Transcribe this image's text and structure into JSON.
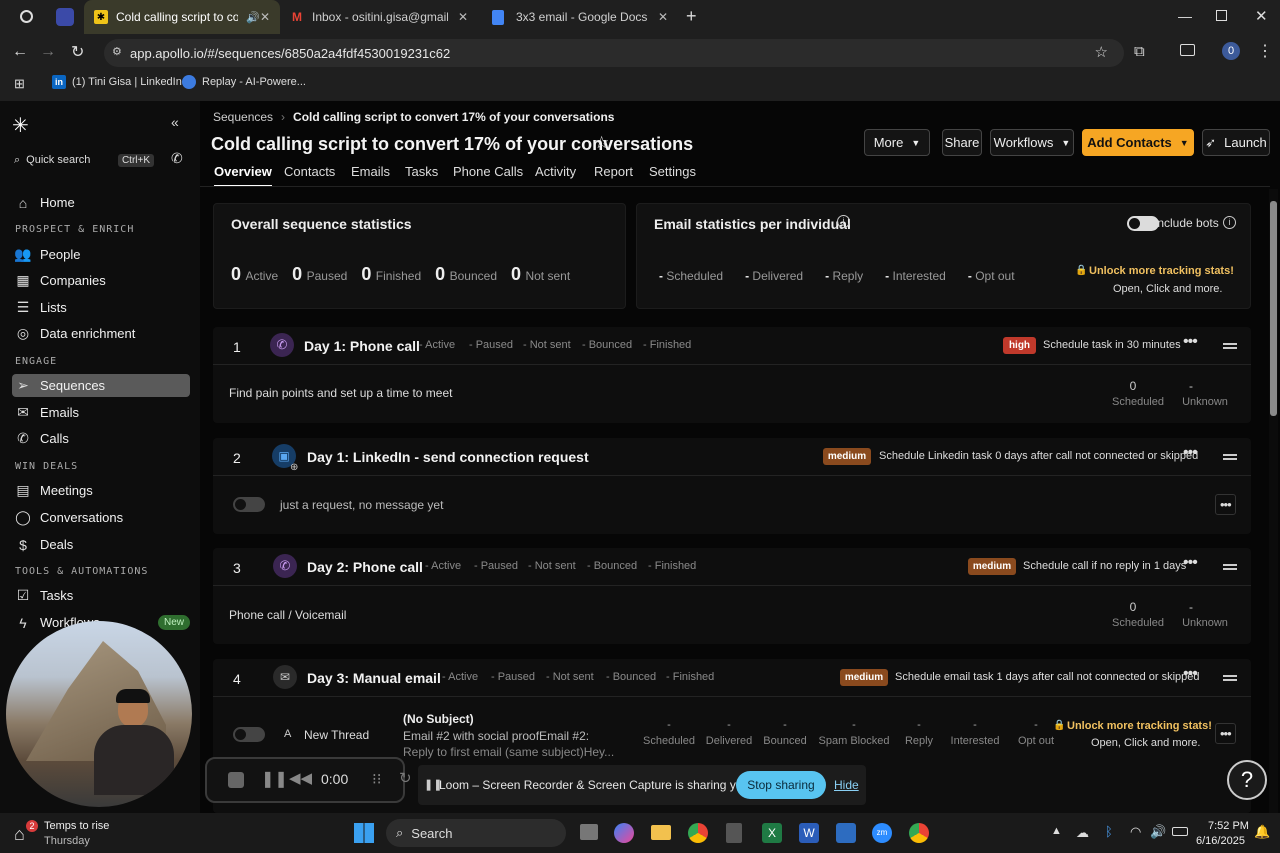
{
  "browser": {
    "tabs": [
      {
        "title": "Cold calling script to conve",
        "active": true
      },
      {
        "title": "Inbox - ositini.gisa@gmail.com"
      },
      {
        "title": "3x3 email - Google Docs"
      }
    ],
    "url": "app.apollo.io/#/sequences/6850a2a4fdf4530019231c62",
    "profile_initial": "0",
    "bookmarks": [
      "(1) Tini Gisa | LinkedIn",
      "Replay - AI-Powere..."
    ]
  },
  "sidebar": {
    "quick_search": "Quick search",
    "shortcut": "Ctrl+K",
    "home": "Home",
    "sections": [
      {
        "heading": "PROSPECT & ENRICH",
        "items": [
          "People",
          "Companies",
          "Lists",
          "Data enrichment"
        ]
      },
      {
        "heading": "ENGAGE",
        "items": [
          "Sequences",
          "Emails",
          "Calls"
        ]
      },
      {
        "heading": "WIN DEALS",
        "items": [
          "Meetings",
          "Conversations",
          "Deals"
        ]
      },
      {
        "heading": "TOOLS & AUTOMATIONS",
        "items": [
          "Tasks",
          "Workflows"
        ]
      }
    ],
    "new_badge": "New",
    "active_item": "Sequences"
  },
  "header": {
    "breadcrumb_root": "Sequences",
    "breadcrumb_current": "Cold calling script to convert 17% of your conversations",
    "title": "Cold calling script to convert 17% of your conversations",
    "buttons": {
      "more": "More",
      "share": "Share",
      "workflows": "Workflows",
      "add_contacts": "Add Contacts",
      "launch": "Launch"
    },
    "tabs": [
      "Overview",
      "Contacts",
      "Emails",
      "Tasks",
      "Phone Calls",
      "Activity",
      "Report",
      "Settings"
    ],
    "active_tab": "Overview"
  },
  "overall_stats": {
    "title": "Overall sequence statistics",
    "items": [
      {
        "value": "0",
        "label": "Active"
      },
      {
        "value": "0",
        "label": "Paused"
      },
      {
        "value": "0",
        "label": "Finished"
      },
      {
        "value": "0",
        "label": "Bounced"
      },
      {
        "value": "0",
        "label": "Not sent"
      }
    ]
  },
  "email_stats": {
    "title": "Email statistics per individual",
    "include_bots": "Include bots",
    "items": [
      {
        "value": "-",
        "label": "Scheduled"
      },
      {
        "value": "-",
        "label": "Delivered"
      },
      {
        "value": "-",
        "label": "Reply"
      },
      {
        "value": "-",
        "label": "Interested"
      },
      {
        "value": "-",
        "label": "Opt out"
      }
    ],
    "unlock": "Unlock more tracking stats!",
    "unlock_sub": "Open, Click and more."
  },
  "steps": [
    {
      "num": "1",
      "title": "Day 1: Phone call",
      "mini": [
        "- Active",
        "- Paused",
        "- Not sent",
        "- Bounced",
        "- Finished"
      ],
      "priority": "high",
      "schedule": "Schedule task in 30 minutes",
      "body": "Find pain points and set up a time to meet",
      "s1v": "0",
      "s1l": "Scheduled",
      "s2v": "-",
      "s2l": "Unknown"
    },
    {
      "num": "2",
      "title": "Day 1: LinkedIn - send connection request",
      "priority": "medium",
      "schedule": "Schedule Linkedin task 0 days after call not connected or skipped",
      "body": "just a request, no message yet"
    },
    {
      "num": "3",
      "title": "Day 2: Phone call",
      "mini": [
        "- Active",
        "- Paused",
        "- Not sent",
        "- Bounced",
        "- Finished"
      ],
      "priority": "medium",
      "schedule": "Schedule call if no reply in 1 days",
      "body": "Phone call / Voicemail",
      "s1v": "0",
      "s1l": "Scheduled",
      "s2v": "-",
      "s2l": "Unknown"
    },
    {
      "num": "4",
      "title": "Day 3: Manual email",
      "mini": [
        "- Active",
        "- Paused",
        "- Not sent",
        "- Bounced",
        "- Finished"
      ],
      "priority": "medium",
      "schedule": "Schedule email task 1 days after call not connected or skipped",
      "thread_letter": "A",
      "thread": "New Thread",
      "subject": "(No Subject)",
      "preview1": "Email #2 with social proofEmail #2:",
      "preview2": "Reply to first email (same subject)Hey...",
      "stats": [
        "Scheduled",
        "Delivered",
        "Bounced",
        "Spam Blocked",
        "Reply",
        "Interested",
        "Opt out"
      ],
      "unlock": "Unlock more tracking stats!",
      "unlock_sub": "Open, Click and more."
    }
  ],
  "recorder": {
    "time": "0:00"
  },
  "share_bar": {
    "text": "Loom – Screen Recorder & Screen Capture is sharing your screen.",
    "stop": "Stop sharing",
    "hide": "Hide"
  },
  "taskbar": {
    "weather_badge": "2",
    "weather_title": "Temps to rise",
    "weather_sub": "Thursday",
    "search": "Search",
    "time": "7:52 PM",
    "date": "6/16/2025"
  },
  "colors": {
    "accent": "#f6a623",
    "high": "#c0392b",
    "medium": "#8a4a1e",
    "stop": "#58c4f0",
    "phone": "#a86fd8",
    "linkedin": "#2e7fd1"
  }
}
